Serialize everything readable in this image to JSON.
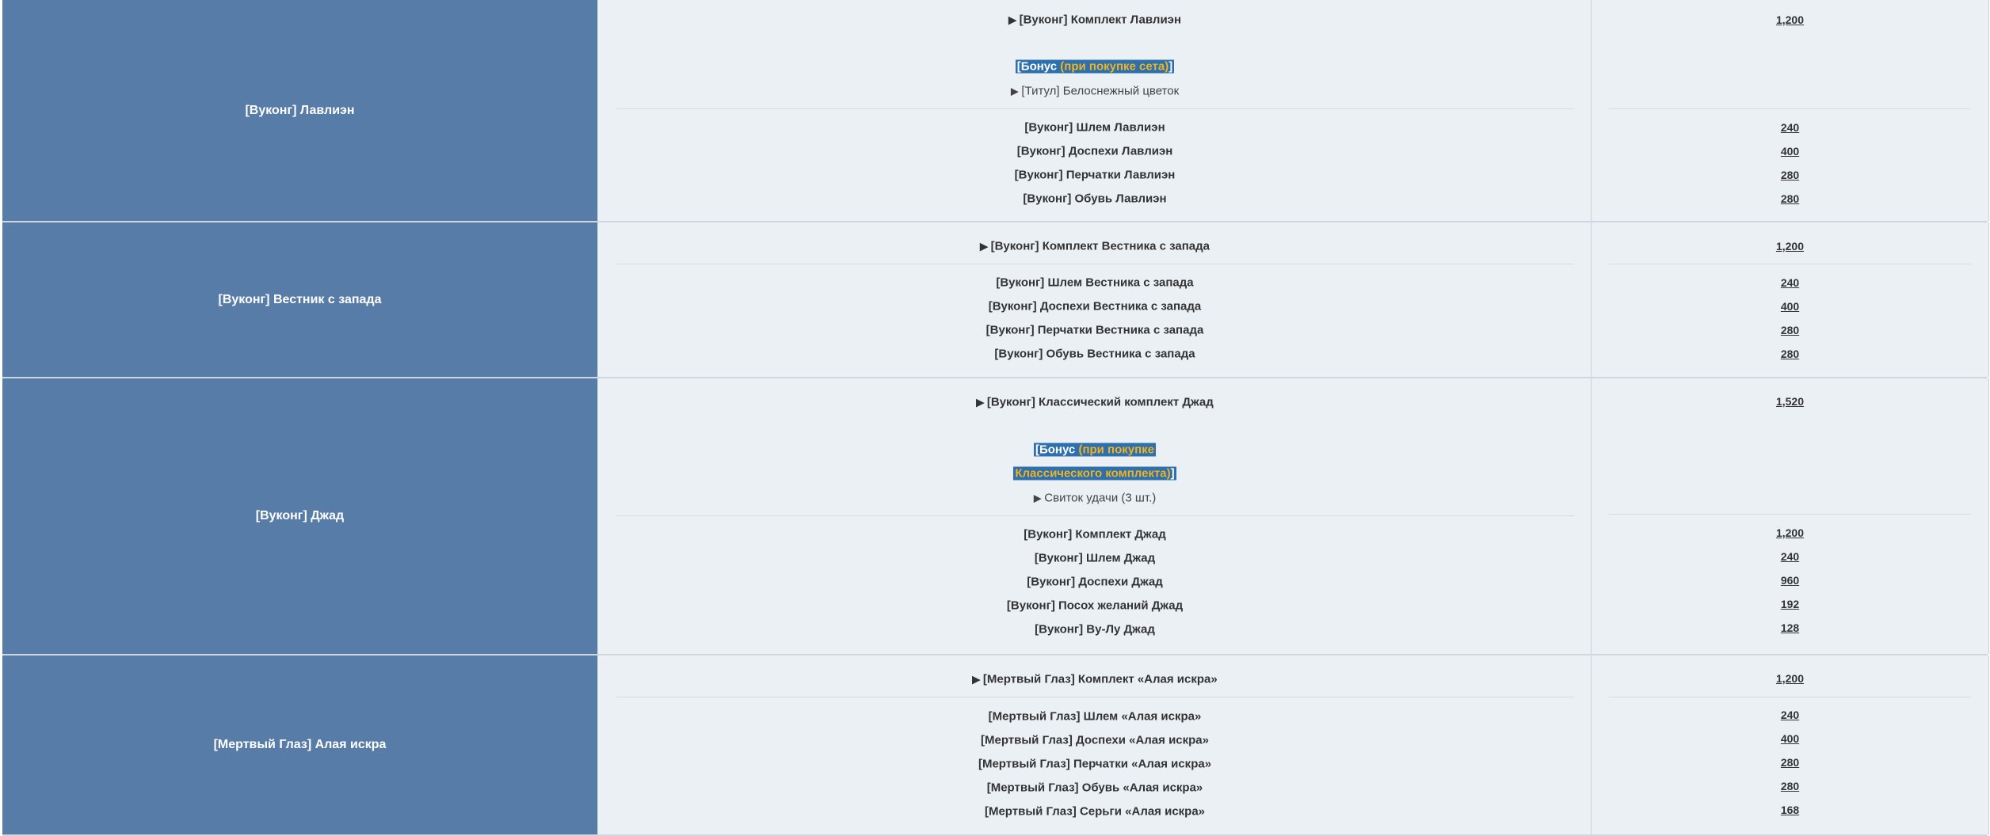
{
  "groups": [
    {
      "name": "[Вуконг] Лавлиэн",
      "set_label": "[Вуконг] Комплект Лавлиэн",
      "set_price": "1,200",
      "bonus_label": "Бонус",
      "bonus_condition": "(при покупке сета)",
      "bonus_item": "[Титул] Белоснежный цветок",
      "items": [
        {
          "label": "[Вуконг] Шлем Лавлиэн",
          "price": "240"
        },
        {
          "label": "[Вуконг] Доспехи Лавлиэн",
          "price": "400"
        },
        {
          "label": "[Вуконг] Перчатки Лавлиэн",
          "price": "280"
        },
        {
          "label": "[Вуконг] Обувь Лавлиэн",
          "price": "280"
        }
      ]
    },
    {
      "name": "[Вуконг] Вестник с запада",
      "set_label": "[Вуконг] Комплект Вестника с запада",
      "set_price": "1,200",
      "items": [
        {
          "label": "[Вуконг] Шлем Вестника с запада",
          "price": "240"
        },
        {
          "label": "[Вуконг] Доспехи Вестника с запада",
          "price": "400"
        },
        {
          "label": "[Вуконг] Перчатки Вестника с запада",
          "price": "280"
        },
        {
          "label": "[Вуконг] Обувь Вестника с запада",
          "price": "280"
        }
      ]
    },
    {
      "name": "[Вуконг] Джад",
      "set_label": "[Вуконг] Классический комплект Джад",
      "set_price": "1,520",
      "bonus_label": "Бонус",
      "bonus_condition_line1": "(при покупке",
      "bonus_condition_line2": "Классического комплекта)",
      "bonus_item": "Свиток удачи (3 шт.)",
      "items": [
        {
          "label": "[Вуконг] Комплект Джад",
          "price": "1,200"
        },
        {
          "label": "[Вуконг] Шлем Джад",
          "price": "240"
        },
        {
          "label": "[Вуконг] Доспехи Джад",
          "price": "960"
        },
        {
          "label": "[Вуконг] Посох желаний Джад",
          "price": "192"
        },
        {
          "label": "[Вуконг] Ву-Лу Джад",
          "price": "128"
        }
      ]
    },
    {
      "name": "[Мертвый Глаз] Алая искра",
      "set_label": "[Мертвый Глаз] Комплект «Алая искра»",
      "set_price": "1,200",
      "items": [
        {
          "label": "[Мертвый Глаз] Шлем «Алая искра»",
          "price": "240"
        },
        {
          "label": "[Мертвый Глаз] Доспехи «Алая искра»",
          "price": "400"
        },
        {
          "label": "[Мертвый Глаз] Перчатки «Алая искра»",
          "price": "280"
        },
        {
          "label": "[Мертвый Глаз] Обувь «Алая искра»",
          "price": "280"
        },
        {
          "label": "[Мертвый Глаз] Серьги «Алая искра»",
          "price": "168"
        }
      ]
    }
  ],
  "colors": {
    "name_cell_bg": "#587ca8",
    "content_bg": "#ebf0f5",
    "bonus_highlight": "#2e6fad",
    "bonus_condition": "#f2b41e"
  }
}
